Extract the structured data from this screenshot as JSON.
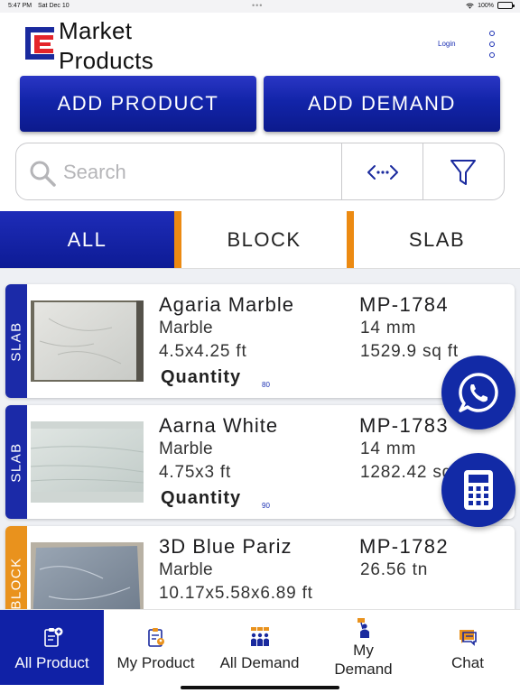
{
  "status_bar": {
    "time": "5:47 PM",
    "date": "Sat Dec 10",
    "battery": "100%"
  },
  "header": {
    "brand_line1": "Market",
    "brand_line2": "Products",
    "login": "Login"
  },
  "actions": {
    "add_product": "ADD PRODUCT",
    "add_demand": "ADD DEMAND"
  },
  "search": {
    "placeholder": "Search"
  },
  "tabs": [
    {
      "label": "ALL",
      "active": true
    },
    {
      "label": "BLOCK",
      "active": false
    },
    {
      "label": "SLAB",
      "active": false
    }
  ],
  "products": [
    {
      "type": "SLAB",
      "name": "Agaria Marble",
      "category": "Marble",
      "dimensions": "4.5x4.25  ft",
      "quantity_label": "Quantity",
      "quantity": "80",
      "code": "MP-1784",
      "thickness": "14 mm",
      "area": "1529.9 sq ft"
    },
    {
      "type": "SLAB",
      "name": "Aarna White",
      "category": "Marble",
      "dimensions": "4.75x3  ft",
      "quantity_label": "Quantity",
      "quantity": "90",
      "code": "MP-1783",
      "thickness": "14 mm",
      "area": "1282.42 sq ft"
    },
    {
      "type": "BLOCK",
      "name": "3D Blue Pariz",
      "category": "Marble",
      "dimensions": "10.17x5.58x6.89  ft",
      "quantity_label": "",
      "quantity": "",
      "code": "MP-1782",
      "thickness": "26.56 tn",
      "area": ""
    }
  ],
  "bottom_nav": [
    {
      "label": "All Product",
      "icon": "clipboard-add-icon",
      "active": true
    },
    {
      "label": "My Product",
      "icon": "clipboard-user-icon",
      "active": false
    },
    {
      "label": "All Demand",
      "icon": "people-demand-icon",
      "active": false
    },
    {
      "label": "My Demand",
      "icon": "person-demand-icon",
      "active": false
    },
    {
      "label": "Chat",
      "icon": "chat-icon",
      "active": false
    }
  ],
  "colors": {
    "primary": "#1021a6",
    "accent_orange": "#ec8a12",
    "logo_red": "#e4252b"
  }
}
